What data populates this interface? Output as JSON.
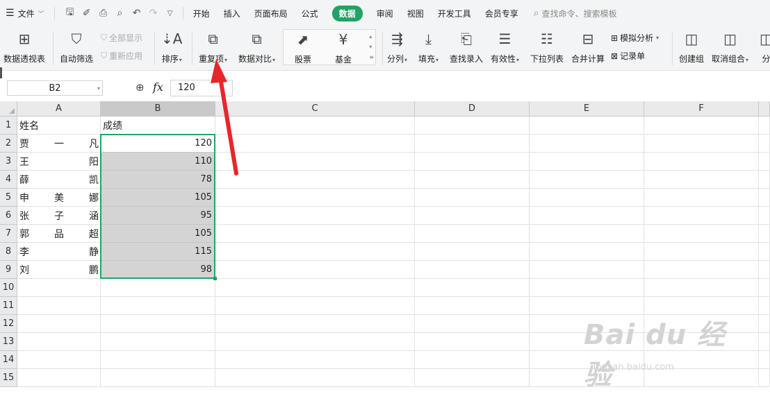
{
  "menubar": {
    "file_label": "文件",
    "tabs": [
      "开始",
      "插入",
      "页面布局",
      "公式",
      "数据",
      "审阅",
      "视图",
      "开发工具",
      "会员专享"
    ],
    "active_tab": "数据",
    "search_placeholder": "查找命令、搜索模板"
  },
  "ribbon": {
    "pivot": "数据透视表",
    "autofilter": "自动筛选",
    "show_all": "全部显示",
    "reapply": "重新应用",
    "sort": "排序",
    "duplicates": "重复项",
    "compare": "数据对比",
    "stock": "股票",
    "fund": "基金",
    "split": "分列",
    "fill": "填充",
    "lookup": "查找录入",
    "validity": "有效性",
    "dropdown": "下拉列表",
    "consolidate": "合并计算",
    "whatif": "模拟分析",
    "record": "记录单",
    "group": "创建组",
    "ungroup": "取消组合",
    "subtotal_partial": "分"
  },
  "formula_bar": {
    "cell_ref": "B2",
    "fx_label": "fx",
    "value": "120"
  },
  "sheet": {
    "columns": [
      "A",
      "B",
      "C",
      "D",
      "E",
      "F"
    ],
    "selected_column": "B",
    "row_numbers": [
      "1",
      "2",
      "3",
      "4",
      "5",
      "6",
      "7",
      "8",
      "9",
      "10",
      "11",
      "12",
      "13",
      "14",
      "15"
    ],
    "header_a": "姓名",
    "header_b": "成绩",
    "rows": [
      {
        "name": [
          "贾",
          "一",
          "凡"
        ],
        "score": "120"
      },
      {
        "name": [
          "王",
          "",
          "阳"
        ],
        "score": "110"
      },
      {
        "name": [
          "薛",
          "",
          "凯"
        ],
        "score": "78"
      },
      {
        "name": [
          "申",
          "美",
          "娜"
        ],
        "score": "105"
      },
      {
        "name": [
          "张",
          "子",
          "涵"
        ],
        "score": "95"
      },
      {
        "name": [
          "郭",
          "品",
          "超"
        ],
        "score": "105"
      },
      {
        "name": [
          "李",
          "",
          "静"
        ],
        "score": "115"
      },
      {
        "name": [
          "刘",
          "",
          "鹏"
        ],
        "score": "98"
      }
    ]
  },
  "watermark": {
    "brand": "Bai du 经验",
    "url": "jingyan.baidu.com"
  },
  "colors": {
    "accent": "#21a366",
    "annotation_arrow": "#e8262a",
    "selection_fill": "#d4d4d4"
  }
}
